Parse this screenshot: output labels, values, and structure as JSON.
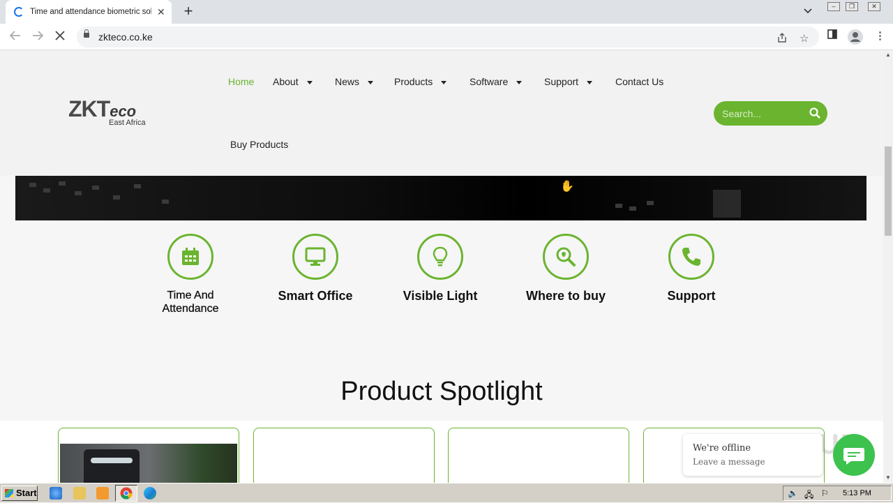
{
  "browser": {
    "tab_title": "Time and attendance biometric solut",
    "url": "zkteco.co.ke"
  },
  "logo": {
    "brand_a": "ZKT",
    "brand_b": "eco",
    "region": "East Africa"
  },
  "nav": {
    "home": "Home",
    "about": "About",
    "news": "News",
    "products": "Products",
    "software": "Software",
    "support": "Support",
    "contact": "Contact Us",
    "buy": "Buy Products",
    "active_color": "#6ab42f"
  },
  "search": {
    "placeholder": "Search..."
  },
  "features": {
    "time": "Time And Attendance",
    "office": "Smart Office",
    "light": "Visible Light",
    "buy": "Where to buy",
    "support": "Support"
  },
  "spotlight": {
    "title": "Product Spotlight"
  },
  "chat": {
    "line1": "We're offline",
    "line2": "Leave a message"
  },
  "watermark": "ANY RUN",
  "taskbar": {
    "start": "Start",
    "clock": "5:13 PM"
  },
  "colors": {
    "accent": "#6ab42f",
    "chat": "#3cc24d"
  }
}
